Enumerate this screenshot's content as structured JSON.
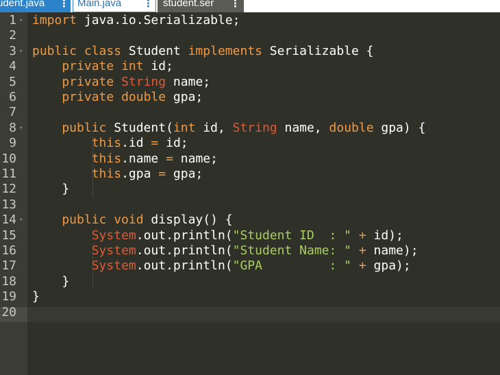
{
  "tabs": [
    {
      "label": "udent.java",
      "menu": "⋮",
      "state": "active"
    },
    {
      "label": "Main.java",
      "menu": "⋮",
      "state": "inactive"
    },
    {
      "label": "student.ser",
      "menu": "⋮",
      "state": "inactive-dark"
    }
  ],
  "editor": {
    "line_numbers": [
      "1",
      "2",
      "3",
      "4",
      "5",
      "6",
      "7",
      "8",
      "9",
      "10",
      "11",
      "12",
      "13",
      "14",
      "15",
      "16",
      "17",
      "18",
      "19",
      "20"
    ],
    "fold_lines": [
      "1",
      "3",
      "8",
      "14"
    ],
    "active_line": "20",
    "colors": {
      "keyword": "#f09a46",
      "type_string": "#e05a35",
      "string_literal": "#a8cf63",
      "text": "#ffffff",
      "background": "#2f3129",
      "gutter": "#3b3c36"
    },
    "lines": [
      {
        "t": [
          {
            "c": "kw",
            "v": "import"
          },
          {
            "c": "plain",
            "v": " java.io.Serializable;"
          }
        ]
      },
      {
        "t": []
      },
      {
        "t": [
          {
            "c": "kw",
            "v": "public class"
          },
          {
            "c": "plain",
            "v": " Student "
          },
          {
            "c": "kw",
            "v": "implements"
          },
          {
            "c": "plain",
            "v": " Serializable {"
          }
        ]
      },
      {
        "t": [
          {
            "c": "kw",
            "v": "    private"
          },
          {
            "c": "plain",
            "v": " "
          },
          {
            "c": "kw",
            "v": "int"
          },
          {
            "c": "plain",
            "v": " id;"
          }
        ]
      },
      {
        "t": [
          {
            "c": "kw",
            "v": "    private"
          },
          {
            "c": "plain",
            "v": " "
          },
          {
            "c": "str-type",
            "v": "String"
          },
          {
            "c": "plain",
            "v": " name;"
          }
        ]
      },
      {
        "t": [
          {
            "c": "kw",
            "v": "    private"
          },
          {
            "c": "plain",
            "v": " "
          },
          {
            "c": "kw",
            "v": "double"
          },
          {
            "c": "plain",
            "v": " gpa;"
          }
        ]
      },
      {
        "t": []
      },
      {
        "t": [
          {
            "c": "kw",
            "v": "    public"
          },
          {
            "c": "plain",
            "v": " Student("
          },
          {
            "c": "kw",
            "v": "int"
          },
          {
            "c": "plain",
            "v": " id, "
          },
          {
            "c": "str-type",
            "v": "String"
          },
          {
            "c": "plain",
            "v": " name, "
          },
          {
            "c": "kw",
            "v": "double"
          },
          {
            "c": "plain",
            "v": " gpa) {"
          }
        ]
      },
      {
        "t": [
          {
            "c": "plain",
            "v": "        "
          },
          {
            "c": "kw",
            "v": "this"
          },
          {
            "c": "plain",
            "v": ".id "
          },
          {
            "c": "op",
            "v": "="
          },
          {
            "c": "plain",
            "v": " id;"
          }
        ]
      },
      {
        "t": [
          {
            "c": "plain",
            "v": "        "
          },
          {
            "c": "kw",
            "v": "this"
          },
          {
            "c": "plain",
            "v": ".name "
          },
          {
            "c": "op",
            "v": "="
          },
          {
            "c": "plain",
            "v": " name;"
          }
        ]
      },
      {
        "t": [
          {
            "c": "plain",
            "v": "        "
          },
          {
            "c": "kw",
            "v": "this"
          },
          {
            "c": "plain",
            "v": ".gpa "
          },
          {
            "c": "op",
            "v": "="
          },
          {
            "c": "plain",
            "v": " gpa;"
          }
        ]
      },
      {
        "t": [
          {
            "c": "plain",
            "v": "    }"
          }
        ]
      },
      {
        "t": []
      },
      {
        "t": [
          {
            "c": "kw",
            "v": "    public void"
          },
          {
            "c": "plain",
            "v": " display() {"
          }
        ]
      },
      {
        "t": [
          {
            "c": "plain",
            "v": "        "
          },
          {
            "c": "sys",
            "v": "System"
          },
          {
            "c": "plain",
            "v": ".out.println("
          },
          {
            "c": "string",
            "v": "\"Student ID  : \""
          },
          {
            "c": "plain",
            "v": " "
          },
          {
            "c": "op",
            "v": "+"
          },
          {
            "c": "plain",
            "v": " id);"
          }
        ]
      },
      {
        "t": [
          {
            "c": "plain",
            "v": "        "
          },
          {
            "c": "sys",
            "v": "System"
          },
          {
            "c": "plain",
            "v": ".out.println("
          },
          {
            "c": "string",
            "v": "\"Student Name: \""
          },
          {
            "c": "plain",
            "v": " "
          },
          {
            "c": "op",
            "v": "+"
          },
          {
            "c": "plain",
            "v": " name);"
          }
        ]
      },
      {
        "t": [
          {
            "c": "plain",
            "v": "        "
          },
          {
            "c": "sys",
            "v": "System"
          },
          {
            "c": "plain",
            "v": ".out.println("
          },
          {
            "c": "string",
            "v": "\"GPA         : \""
          },
          {
            "c": "plain",
            "v": " "
          },
          {
            "c": "op",
            "v": "+"
          },
          {
            "c": "plain",
            "v": " gpa);"
          }
        ]
      },
      {
        "t": [
          {
            "c": "plain",
            "v": "    }"
          }
        ]
      },
      {
        "t": [
          {
            "c": "plain",
            "v": "}"
          }
        ]
      },
      {
        "t": []
      }
    ]
  }
}
